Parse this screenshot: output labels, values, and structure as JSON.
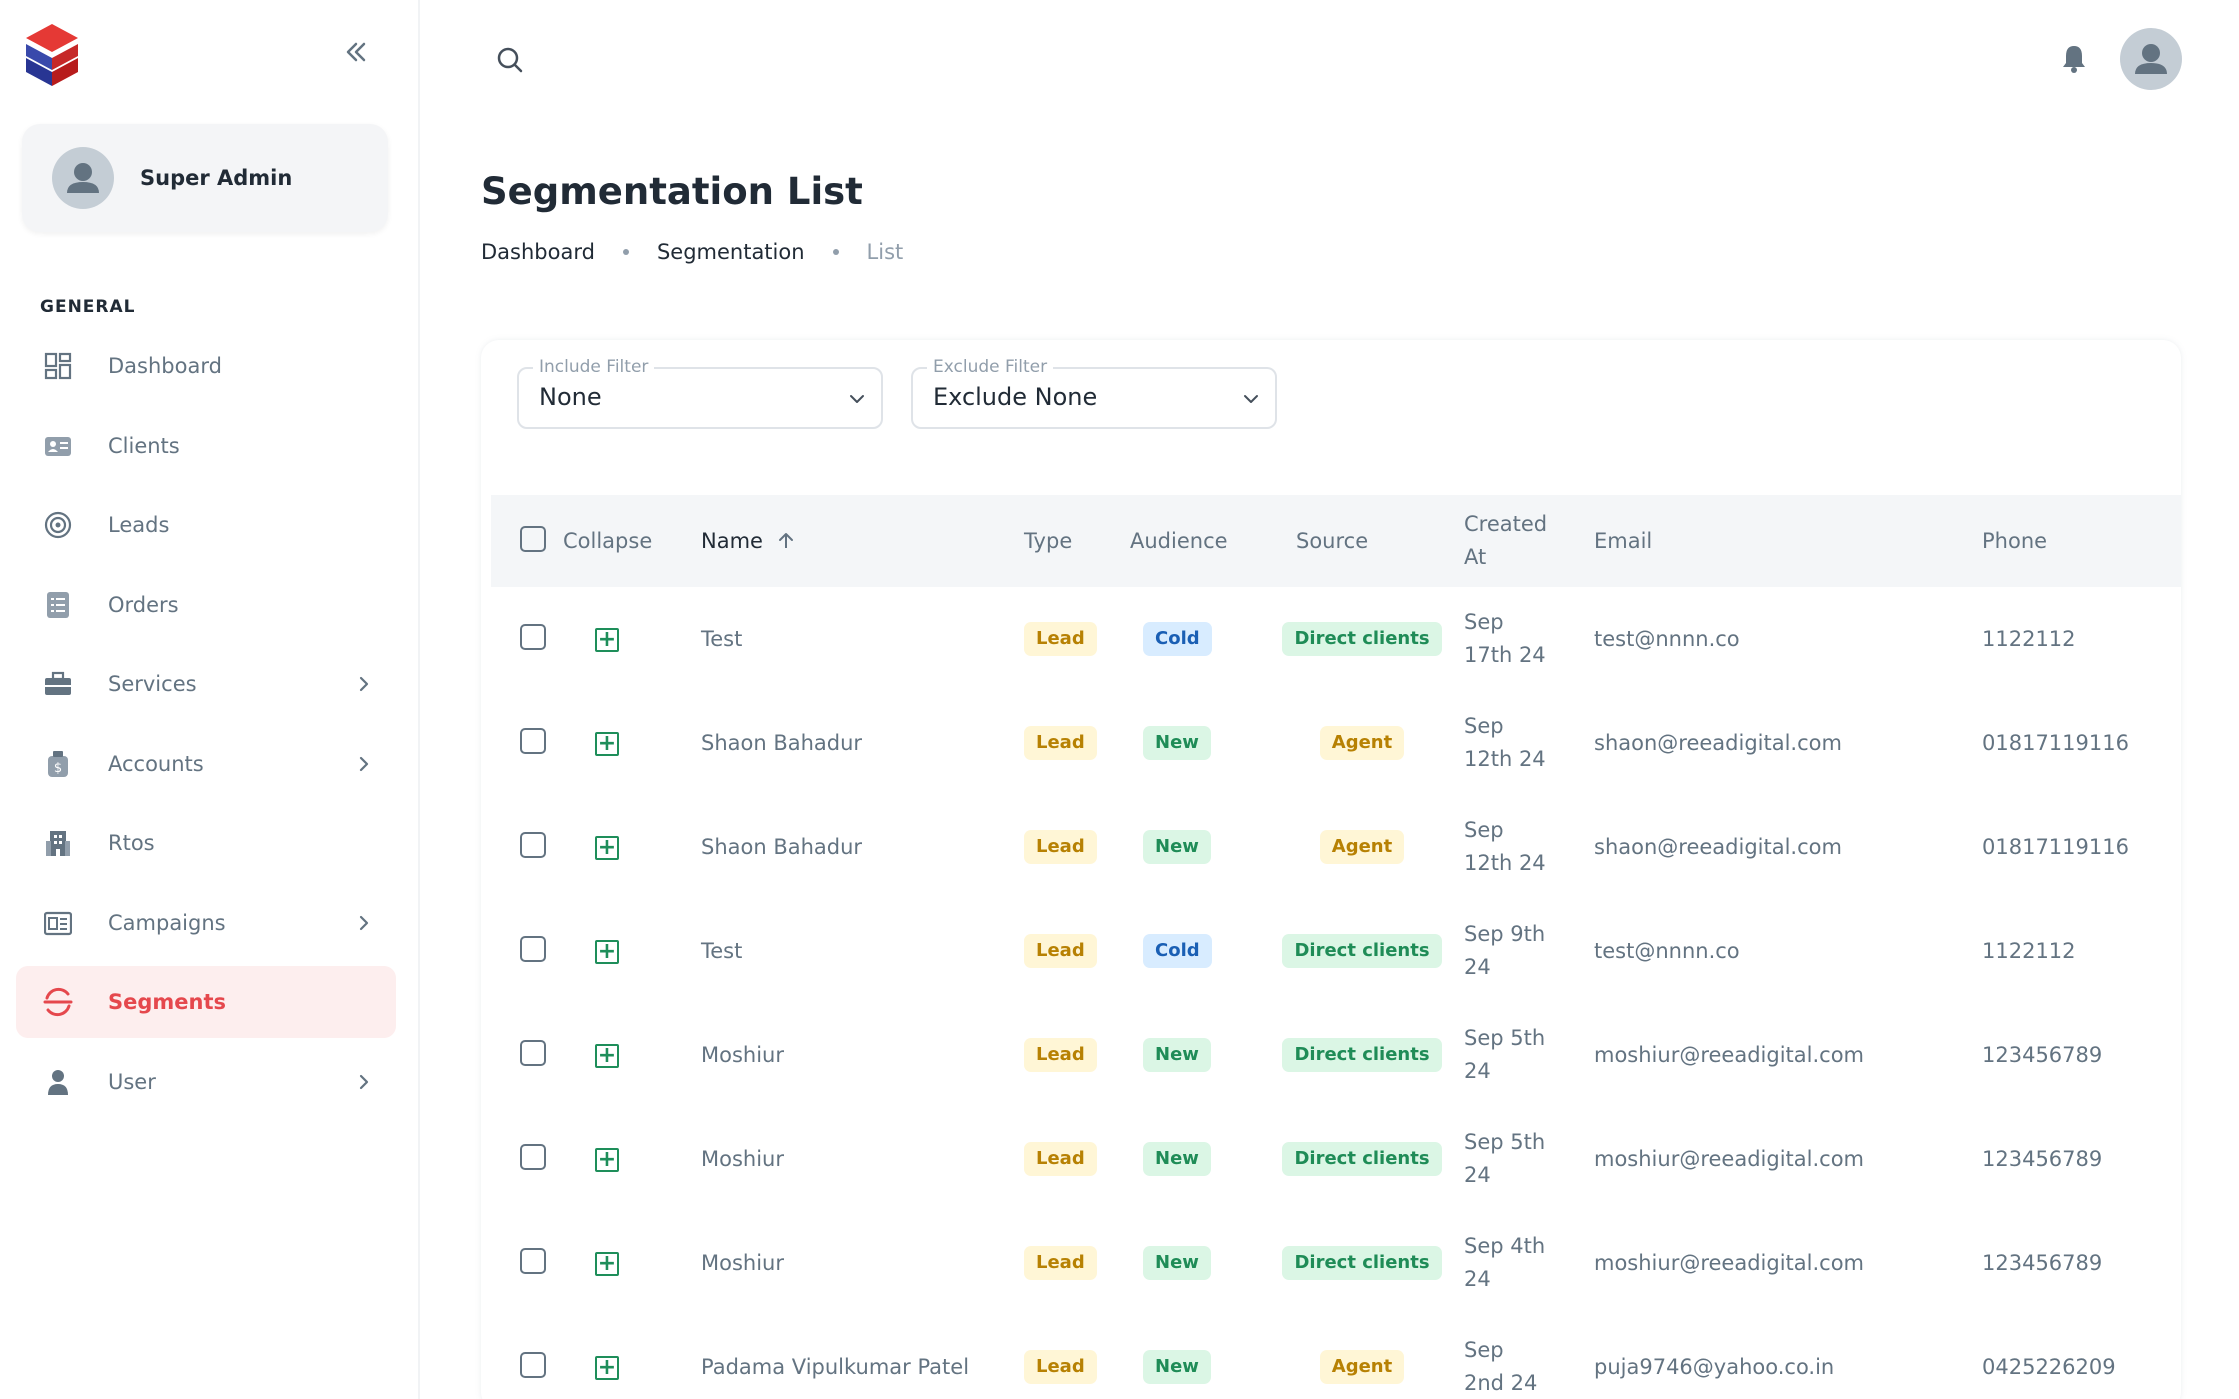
{
  "sidebar": {
    "account_name": "Super Admin",
    "section_label": "GENERAL",
    "items": [
      {
        "label": "Dashboard",
        "icon": "dashboard-icon",
        "has_children": false,
        "active": false
      },
      {
        "label": "Clients",
        "icon": "contact-card-icon",
        "has_children": false,
        "active": false
      },
      {
        "label": "Leads",
        "icon": "target-icon",
        "has_children": false,
        "active": false
      },
      {
        "label": "Orders",
        "icon": "list-document-icon",
        "has_children": false,
        "active": false
      },
      {
        "label": "Services",
        "icon": "briefcase-icon",
        "has_children": true,
        "active": false
      },
      {
        "label": "Accounts",
        "icon": "money-bag-icon",
        "has_children": true,
        "active": false
      },
      {
        "label": "Rtos",
        "icon": "building-icon",
        "has_children": false,
        "active": false
      },
      {
        "label": "Campaigns",
        "icon": "newspaper-icon",
        "has_children": true,
        "active": false
      },
      {
        "label": "Segments",
        "icon": "segment-icon",
        "has_children": false,
        "active": true
      },
      {
        "label": "User",
        "icon": "user-icon",
        "has_children": true,
        "active": false
      }
    ]
  },
  "header": {
    "title": "Segmentation List",
    "breadcrumbs": [
      "Dashboard",
      "Segmentation",
      "List"
    ]
  },
  "filters": {
    "include": {
      "label": "Include Filter",
      "value": "None"
    },
    "exclude": {
      "label": "Exclude Filter",
      "value": "Exclude None"
    }
  },
  "table": {
    "columns": {
      "collapse": "Collapse",
      "name": "Name",
      "type": "Type",
      "audience": "Audience",
      "source": "Source",
      "created_line1": "Created",
      "created_line2": "At",
      "email": "Email",
      "phone": "Phone"
    },
    "rows": [
      {
        "name": "Test",
        "type": "Lead",
        "audience": "Cold",
        "source": "Direct clients",
        "created_1": "Sep",
        "created_2": "17th 24",
        "email": "test@nnnn.co",
        "phone": "1122112"
      },
      {
        "name": "Shaon Bahadur",
        "type": "Lead",
        "audience": "New",
        "source": "Agent",
        "created_1": "Sep",
        "created_2": "12th 24",
        "email": "shaon@reeadigital.com",
        "phone": "01817119116"
      },
      {
        "name": "Shaon Bahadur",
        "type": "Lead",
        "audience": "New",
        "source": "Agent",
        "created_1": "Sep",
        "created_2": "12th 24",
        "email": "shaon@reeadigital.com",
        "phone": "01817119116"
      },
      {
        "name": "Test",
        "type": "Lead",
        "audience": "Cold",
        "source": "Direct clients",
        "created_1": "Sep 9th",
        "created_2": "24",
        "email": "test@nnnn.co",
        "phone": "1122112"
      },
      {
        "name": "Moshiur",
        "type": "Lead",
        "audience": "New",
        "source": "Direct clients",
        "created_1": "Sep 5th",
        "created_2": "24",
        "email": "moshiur@reeadigital.com",
        "phone": "123456789"
      },
      {
        "name": "Moshiur",
        "type": "Lead",
        "audience": "New",
        "source": "Direct clients",
        "created_1": "Sep 5th",
        "created_2": "24",
        "email": "moshiur@reeadigital.com",
        "phone": "123456789"
      },
      {
        "name": "Moshiur",
        "type": "Lead",
        "audience": "New",
        "source": "Direct clients",
        "created_1": "Sep 4th",
        "created_2": "24",
        "email": "moshiur@reeadigital.com",
        "phone": "123456789"
      },
      {
        "name": "Padama Vipulkumar Patel",
        "type": "Lead",
        "audience": "New",
        "source": "Agent",
        "created_1": "Sep",
        "created_2": "2nd 24",
        "email": "puja9746@yahoo.co.in",
        "phone": "0425226209"
      }
    ]
  },
  "colors": {
    "accent": "#e5484d",
    "lead_badge": "#fff6d6",
    "cold_badge": "#d8ecff",
    "new_badge": "#dbf6e5"
  }
}
